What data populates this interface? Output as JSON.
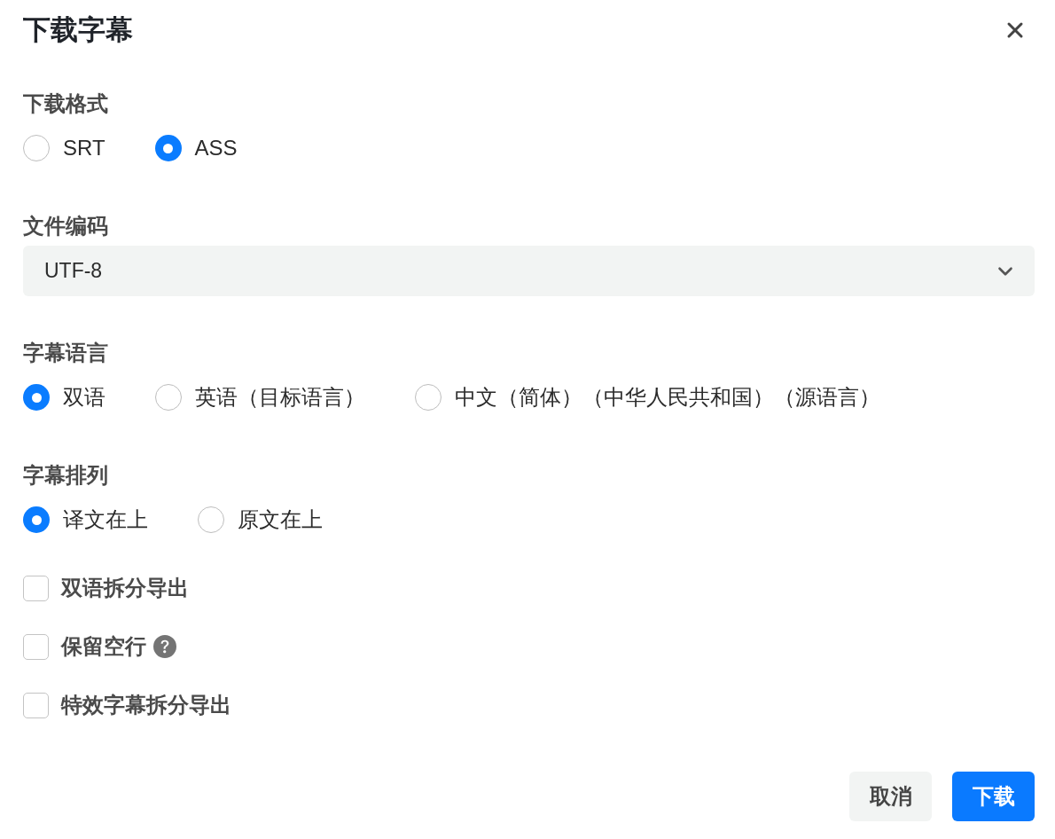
{
  "dialog": {
    "title": "下载字幕"
  },
  "sections": [
    {
      "kind": "radio",
      "label": "下载格式",
      "options": [
        {
          "label": "SRT",
          "selected": false
        },
        {
          "label": "ASS",
          "selected": true
        }
      ]
    },
    {
      "kind": "select",
      "label": "文件编码",
      "value": "UTF-8"
    },
    {
      "kind": "radio",
      "label": "字幕语言",
      "options": [
        {
          "label": "双语",
          "selected": true
        },
        {
          "label": "英语（目标语言）",
          "selected": false
        },
        {
          "label": "中文（简体）（中华人民共和国）（源语言）",
          "selected": false
        }
      ]
    },
    {
      "kind": "radio",
      "label": "字幕排列",
      "options": [
        {
          "label": "译文在上",
          "selected": true
        },
        {
          "label": "原文在上",
          "selected": false
        }
      ]
    }
  ],
  "checkboxes": [
    {
      "label": "双语拆分导出",
      "checked": false,
      "help": false
    },
    {
      "label": "保留空行",
      "checked": false,
      "help": true
    },
    {
      "label": "特效字幕拆分导出",
      "checked": false,
      "help": false
    }
  ],
  "buttons": [
    {
      "label": "取消",
      "kind": "secondary"
    },
    {
      "label": "下载",
      "kind": "primary"
    }
  ]
}
